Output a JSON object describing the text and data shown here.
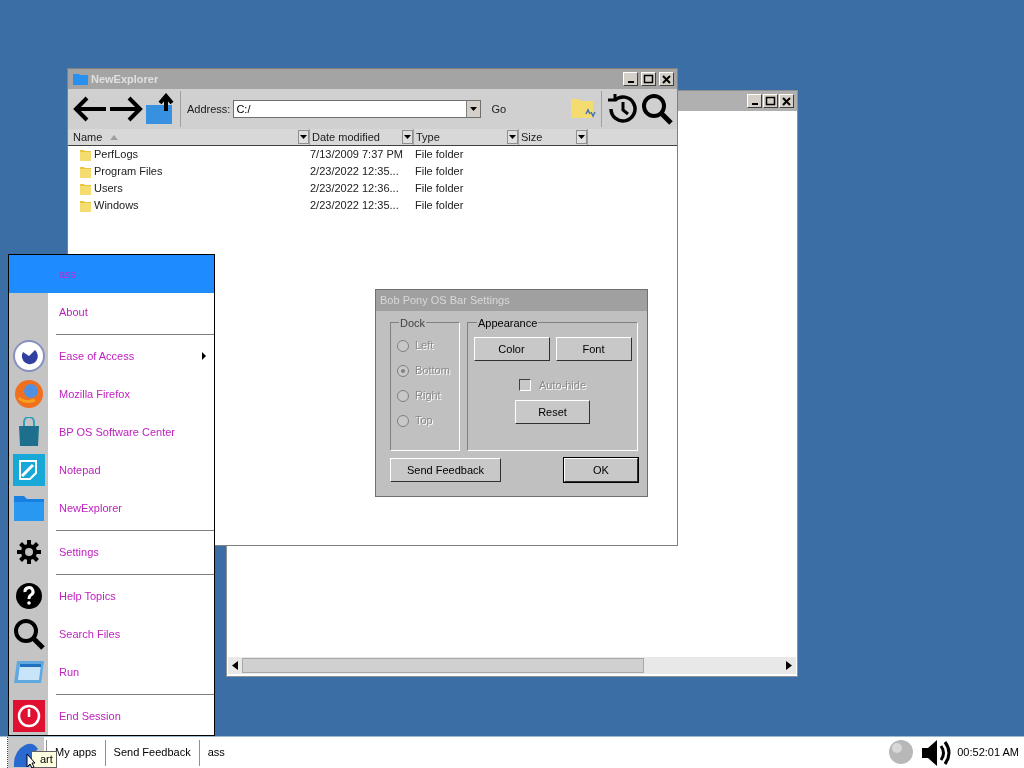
{
  "explorer": {
    "title": "NewExplorer",
    "address_label": "Address:",
    "address": "C:/",
    "go": "Go",
    "columns": [
      {
        "label": "Name",
        "sorted": true
      },
      {
        "label": "Date modified",
        "sorted": false
      },
      {
        "label": "Type",
        "sorted": false
      },
      {
        "label": "Size",
        "sorted": false
      }
    ],
    "rows": [
      {
        "name": "PerfLogs",
        "date": "7/13/2009 7:37 PM",
        "type": "File folder"
      },
      {
        "name": "Program Files",
        "date": "2/23/2022 12:35...",
        "type": "File folder"
      },
      {
        "name": "Users",
        "date": "2/23/2022 12:36...",
        "type": "File folder"
      },
      {
        "name": "Windows",
        "date": "2/23/2022 12:35...",
        "type": "File folder"
      }
    ]
  },
  "dialog": {
    "title": "Bob Pony OS Bar Settings",
    "dock": {
      "label": "Dock",
      "options": [
        {
          "label": "Left",
          "selected": false,
          "disabled": true
        },
        {
          "label": "Bottom",
          "selected": true,
          "disabled": true
        },
        {
          "label": "Right",
          "selected": false,
          "disabled": true
        },
        {
          "label": "Top",
          "selected": false,
          "disabled": true
        }
      ]
    },
    "appearance": {
      "label": "Appearance",
      "buttons": [
        "Color",
        "Font"
      ],
      "auto_hide": {
        "label": "Auto-hide",
        "checked": false,
        "disabled": true
      },
      "reset": "Reset"
    },
    "buttons": [
      "Send Feedback",
      "OK"
    ]
  },
  "start_menu": {
    "user": "ass",
    "items": [
      {
        "label": "About",
        "kind": "none",
        "submenu": false
      },
      {
        "kind": "divider"
      },
      {
        "label": "Ease of Access",
        "kind": "access",
        "submenu": true
      },
      {
        "label": "Mozilla Firefox",
        "kind": "browser",
        "submenu": false
      },
      {
        "label": "BP OS Software Center",
        "kind": "bag",
        "submenu": false
      },
      {
        "label": "Notepad",
        "kind": "notepad",
        "submenu": false
      },
      {
        "label": "NewExplorer",
        "kind": "folder",
        "submenu": false
      },
      {
        "kind": "divider"
      },
      {
        "label": "Settings",
        "kind": "gear",
        "submenu": false
      },
      {
        "kind": "divider"
      },
      {
        "label": "Help Topics",
        "kind": "help",
        "submenu": false
      },
      {
        "label": "Search Files",
        "kind": "search",
        "submenu": false
      },
      {
        "label": "Run",
        "kind": "run",
        "submenu": false
      },
      {
        "kind": "divider"
      },
      {
        "label": "End Session",
        "kind": "power",
        "submenu": false
      }
    ]
  },
  "taskbar": {
    "tooltip": "art",
    "items": [
      "My apps",
      "Send Feedback",
      "ass"
    ],
    "clock": "00:52:01 AM"
  }
}
